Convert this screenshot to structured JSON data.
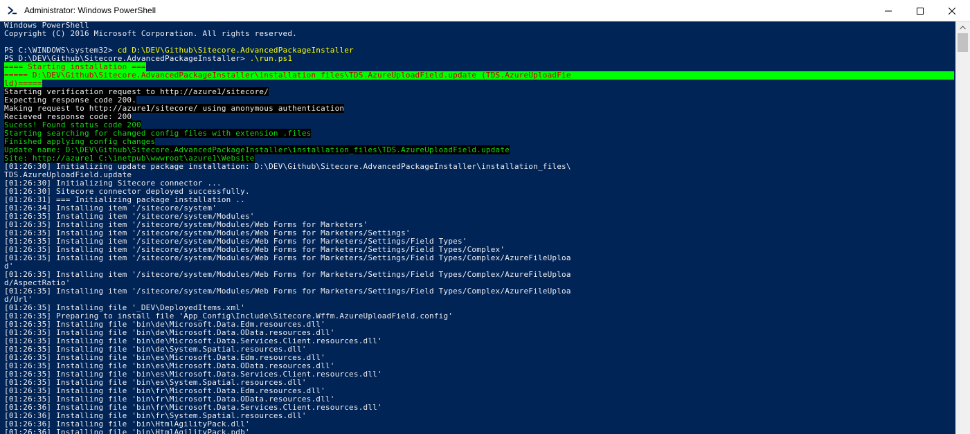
{
  "window": {
    "title": "Administrator: Windows PowerShell",
    "minimize_glyph": "—",
    "close_glyph": "✕"
  },
  "colors": {
    "console_bg": "#012456",
    "text": "#eeedf0",
    "prompt_cmd": "#ffff00",
    "green_text": "#13d713",
    "highlight_bg": "#00ff00",
    "highlight_fg": "#c00000"
  },
  "console": {
    "lines": [
      {
        "text": "Windows PowerShell",
        "style": "white"
      },
      {
        "text": "Copyright (C) 2016 Microsoft Corporation. All rights reserved.",
        "style": "white"
      },
      {
        "text": "",
        "style": "white"
      },
      {
        "prompt": "PS C:\\WINDOWS\\system32> ",
        "cmd": "cd D:\\DEV\\Github\\Sitecore.AdvancedPackageInstaller",
        "style": "prompt"
      },
      {
        "prompt": "PS D:\\DEV\\Github\\Sitecore.AdvancedPackageInstaller> ",
        "cmd": ".\\run.ps1",
        "style": "prompt"
      },
      {
        "text": "==== Starting installation ===",
        "style": "hl-red"
      },
      {
        "text": "===== D:\\DEV\\Github\\Sitecore.AdvancedPackageInstaller\\installation_files\\TDS.AzureUploadField.update (TDS.AzureUploadFie",
        "style": "hl-full"
      },
      {
        "text": "ld)=====",
        "style": "hl"
      },
      {
        "text": "Starting verification request to http://azure1/sitecore/",
        "style": "white-bg"
      },
      {
        "text": "Expecting response code 200.",
        "style": "white-bg"
      },
      {
        "text": "Making request to http://azure1/sitecore/ using anonymous authentication",
        "style": "white-bg"
      },
      {
        "text": "Recieved response code: 200",
        "style": "white-bg"
      },
      {
        "text": "Sucess! Found status code 200",
        "style": "green-bg"
      },
      {
        "text": "Starting searching for changed config files with extension .files",
        "style": "green-bg"
      },
      {
        "text": "Finished applying config changes",
        "style": "green-bg"
      },
      {
        "text": "Update name: D:\\DEV\\Github\\Sitecore.AdvancedPackageInstaller\\installation_files\\TDS.AzureUploadField.update",
        "style": "green-bg"
      },
      {
        "text": "Site: http://azure1 C:\\inetpub\\wwwroot\\azure1\\Website",
        "style": "green-bg"
      },
      {
        "text": "[01:26:30] Initializing update package installation: D:\\DEV\\Github\\Sitecore.AdvancedPackageInstaller\\installation_files\\",
        "style": "white"
      },
      {
        "text": "TDS.AzureUploadField.update",
        "style": "white"
      },
      {
        "text": "[01:26:30] Initializing Sitecore connector ...",
        "style": "white"
      },
      {
        "text": "[01:26:30] Sitecore connector deployed successfully.",
        "style": "white"
      },
      {
        "text": "[01:26:31] === Initializing package installation ..",
        "style": "white"
      },
      {
        "text": "[01:26:34] Installing item '/sitecore/system'",
        "style": "white"
      },
      {
        "text": "[01:26:35] Installing item '/sitecore/system/Modules'",
        "style": "white"
      },
      {
        "text": "[01:26:35] Installing item '/sitecore/system/Modules/Web Forms for Marketers'",
        "style": "white"
      },
      {
        "text": "[01:26:35] Installing item '/sitecore/system/Modules/Web Forms for Marketers/Settings'",
        "style": "white"
      },
      {
        "text": "[01:26:35] Installing item '/sitecore/system/Modules/Web Forms for Marketers/Settings/Field Types'",
        "style": "white"
      },
      {
        "text": "[01:26:35] Installing item '/sitecore/system/Modules/Web Forms for Marketers/Settings/Field Types/Complex'",
        "style": "white"
      },
      {
        "text": "[01:26:35] Installing item '/sitecore/system/Modules/Web Forms for Marketers/Settings/Field Types/Complex/AzureFileUploa",
        "style": "white"
      },
      {
        "text": "d'",
        "style": "white"
      },
      {
        "text": "[01:26:35] Installing item '/sitecore/system/Modules/Web Forms for Marketers/Settings/Field Types/Complex/AzureFileUploa",
        "style": "white"
      },
      {
        "text": "d/AspectRatio'",
        "style": "white"
      },
      {
        "text": "[01:26:35] Installing item '/sitecore/system/Modules/Web Forms for Marketers/Settings/Field Types/Complex/AzureFileUploa",
        "style": "white"
      },
      {
        "text": "d/Url'",
        "style": "white"
      },
      {
        "text": "[01:26:35] Installing file '_DEV\\DeployedItems.xml'",
        "style": "white"
      },
      {
        "text": "[01:26:35] Preparing to install file 'App_Config\\Include\\Sitecore.Wffm.AzureUploadField.config'",
        "style": "white"
      },
      {
        "text": "[01:26:35] Installing file 'bin\\de\\Microsoft.Data.Edm.resources.dll'",
        "style": "white"
      },
      {
        "text": "[01:26:35] Installing file 'bin\\de\\Microsoft.Data.OData.resources.dll'",
        "style": "white"
      },
      {
        "text": "[01:26:35] Installing file 'bin\\de\\Microsoft.Data.Services.Client.resources.dll'",
        "style": "white"
      },
      {
        "text": "[01:26:35] Installing file 'bin\\de\\System.Spatial.resources.dll'",
        "style": "white"
      },
      {
        "text": "[01:26:35] Installing file 'bin\\es\\Microsoft.Data.Edm.resources.dll'",
        "style": "white"
      },
      {
        "text": "[01:26:35] Installing file 'bin\\es\\Microsoft.Data.OData.resources.dll'",
        "style": "white"
      },
      {
        "text": "[01:26:35] Installing file 'bin\\es\\Microsoft.Data.Services.Client.resources.dll'",
        "style": "white"
      },
      {
        "text": "[01:26:35] Installing file 'bin\\es\\System.Spatial.resources.dll'",
        "style": "white"
      },
      {
        "text": "[01:26:35] Installing file 'bin\\fr\\Microsoft.Data.Edm.resources.dll'",
        "style": "white"
      },
      {
        "text": "[01:26:35] Installing file 'bin\\fr\\Microsoft.Data.OData.resources.dll'",
        "style": "white"
      },
      {
        "text": "[01:26:36] Installing file 'bin\\fr\\Microsoft.Data.Services.Client.resources.dll'",
        "style": "white"
      },
      {
        "text": "[01:26:36] Installing file 'bin\\fr\\System.Spatial.resources.dll'",
        "style": "white"
      },
      {
        "text": "[01:26:36] Installing file 'bin\\HtmlAgilityPack.dll'",
        "style": "white"
      },
      {
        "text": "[01:26:36] Installing file 'bin\\HtmlAgilityPack.pdb'",
        "style": "white"
      }
    ]
  }
}
